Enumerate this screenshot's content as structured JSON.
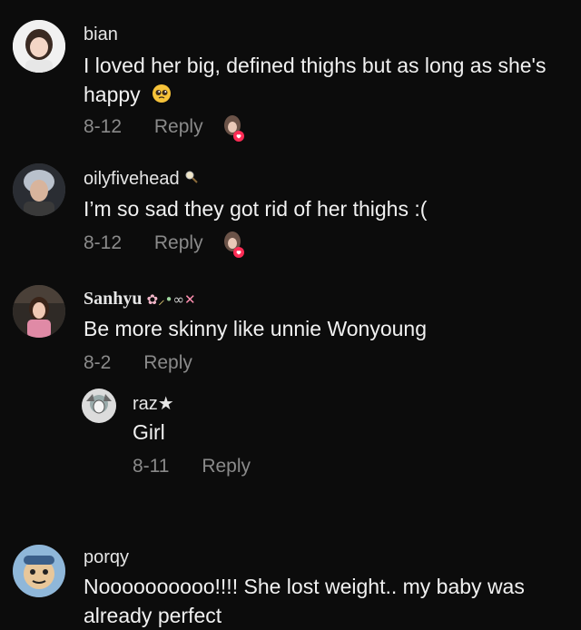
{
  "comments": [
    {
      "username": "bian",
      "text_line1": "I loved her big, defined thighs but as long as she's",
      "text_line2": "happy",
      "date": "8-12",
      "reply": "Reply"
    },
    {
      "username": "oilyfivehead",
      "text_line1": "I’m so sad they got rid of her thighs :(",
      "date": "8-12",
      "reply": "Reply"
    },
    {
      "username": "Sanhyu",
      "text_line1": "Be more skinny like unnie Wonyoung",
      "date": "8-2",
      "reply": "Reply",
      "replies": [
        {
          "username": "raz★",
          "text_line1": "Girl",
          "date": "8-11",
          "reply": "Reply"
        }
      ]
    },
    {
      "username": "porqy",
      "text_line1": "Noooooooooo!!!! She lost weight.. my baby was",
      "text_line2": "already perfect"
    }
  ],
  "icons": {
    "pleading_emoji": "pleading-face-emoji",
    "creator_liked": "creator-liked-avatar-icon"
  }
}
